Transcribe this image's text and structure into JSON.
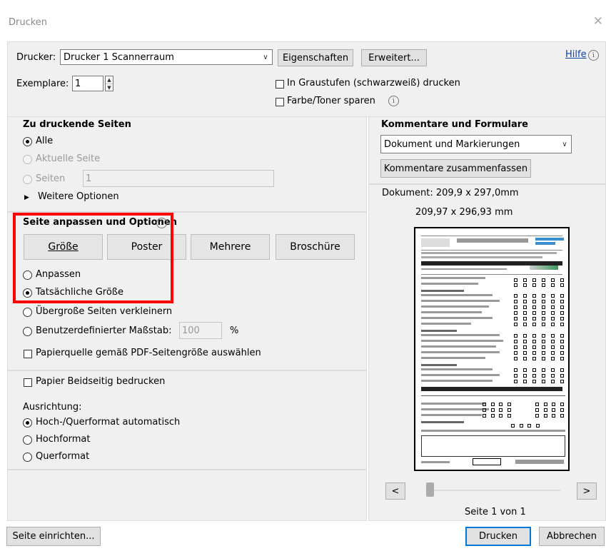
{
  "window": {
    "title": "Drucken"
  },
  "printer": {
    "label": "Drucker:",
    "selected": "Drucker 1 Scannerraum",
    "properties_btn": "Eigenschaften",
    "advanced_btn": "Erweitert...",
    "help_link": "Hilfe",
    "copies_label": "Exemplare:",
    "copies_value": "1",
    "grayscale_label": "In Graustufen (schwarzweiß) drucken",
    "toner_label": "Farbe/Toner sparen"
  },
  "pages": {
    "header": "Zu druckende Seiten",
    "all": "Alle",
    "current": "Aktuelle Seite",
    "pages_label": "Seiten",
    "pages_value": "1",
    "more_options": "Weitere Optionen"
  },
  "sizing": {
    "header": "Seite anpassen und Optionen",
    "tabs": [
      "Größe",
      "Poster",
      "Mehrere",
      "Broschüre"
    ],
    "fit": "Anpassen",
    "actual": "Tatsächliche Größe",
    "shrink": "Übergroße Seiten verkleinern",
    "custom": "Benutzerdefinierter Maßstab:",
    "custom_value": "100",
    "percent": "%",
    "paper_source": "Papierquelle gemäß PDF-Seitengröße auswählen"
  },
  "duplex": {
    "label": "Papier Beidseitig bedrucken",
    "orientation_label": "Ausrichtung:",
    "auto": "Hoch-/Querformat automatisch",
    "portrait": "Hochformat",
    "landscape": "Querformat"
  },
  "comments": {
    "header": "Kommentare und Formulare",
    "selected": "Dokument und Markierungen",
    "summarize_btn": "Kommentare zusammenfassen"
  },
  "preview": {
    "document_size": "Dokument: 209,9 x 297,0mm",
    "page_size": "209,97 x 296,93 mm",
    "page_indicator": "Seite 1 von 1",
    "prev": "<",
    "next": ">"
  },
  "footer": {
    "page_setup": "Seite einrichten...",
    "print": "Drucken",
    "cancel": "Abbrechen"
  }
}
